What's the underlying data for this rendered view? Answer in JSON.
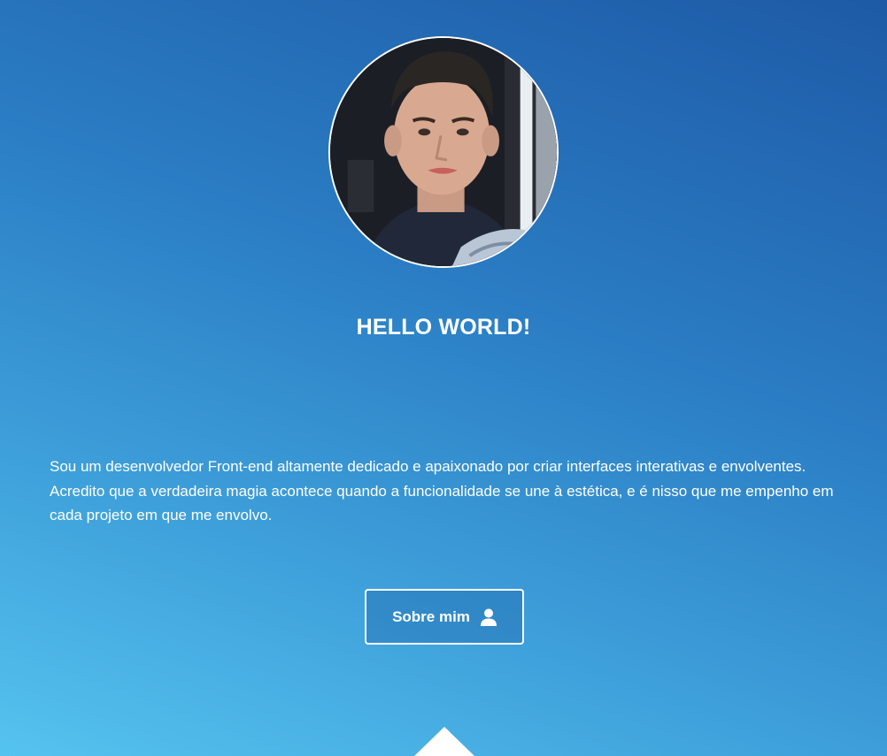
{
  "hero": {
    "title": "HELLO WORLD!",
    "intro": "Sou um desenvolvedor Front-end altamente dedicado e apaixonado por criar interfaces interativas e envolventes. Acredito que a verdadeira magia acontece quando a funcionalidade se une à estética, e é nisso que me empenho em cada projeto em que me envolvo.",
    "about_button_label": "Sobre mim",
    "about_button_icon": "user-icon",
    "avatar_icon": "profile-photo"
  },
  "colors": {
    "gradient_light": "#55c3ef",
    "gradient_dark": "#1e5aa6",
    "text": "#ffffff"
  }
}
